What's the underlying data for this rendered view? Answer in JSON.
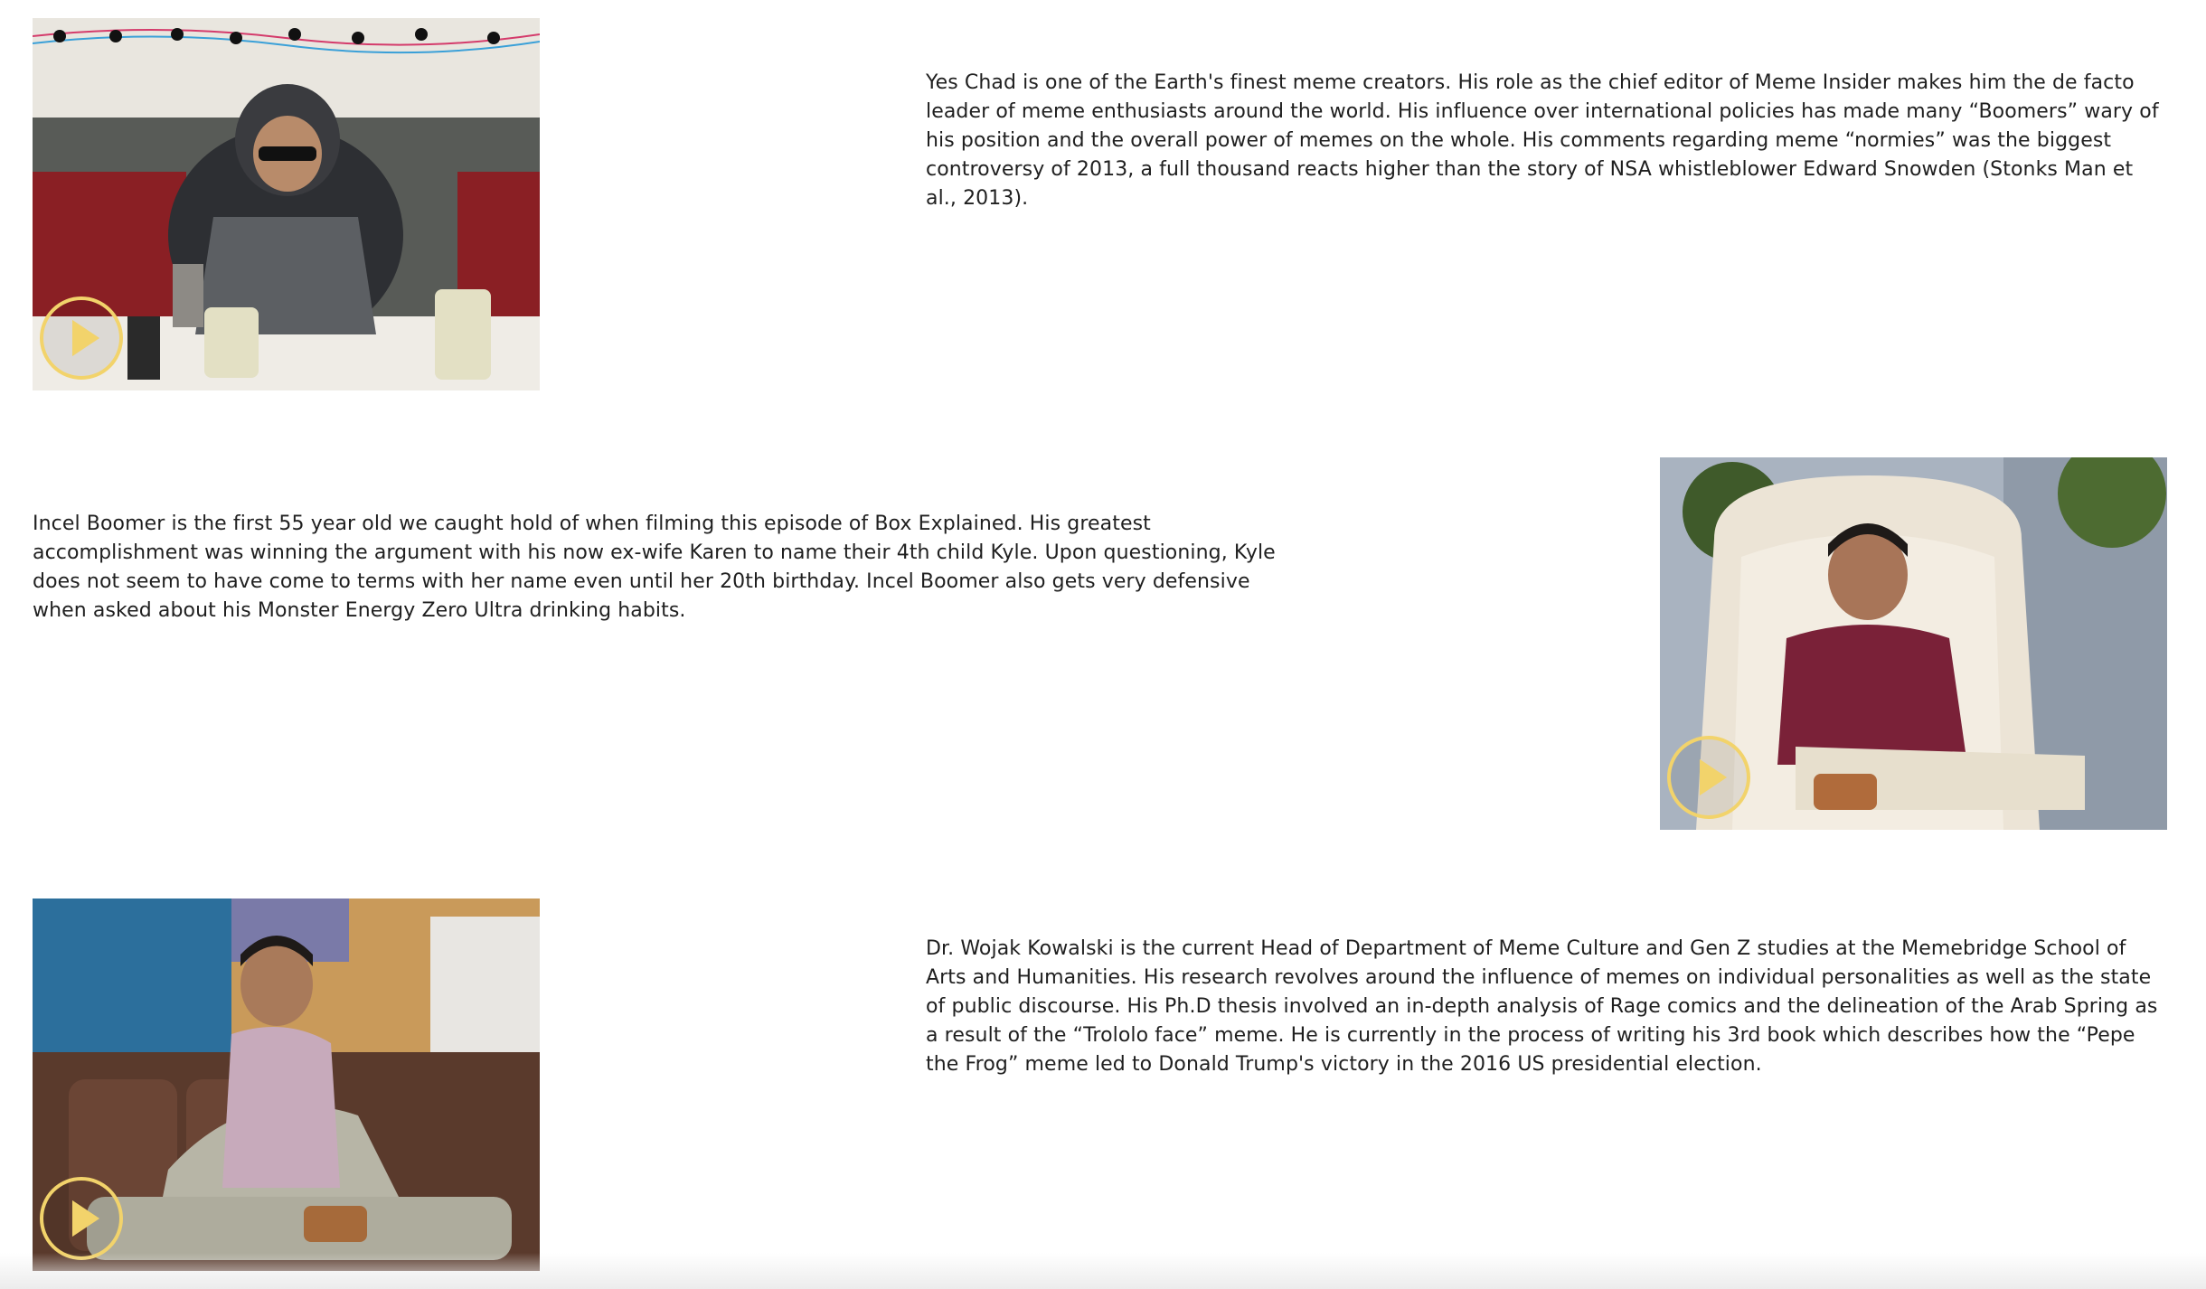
{
  "profiles": [
    {
      "video_label": "Yes Chad video",
      "bio": "Yes Chad is one of the Earth's finest meme creators. His role as the chief editor of Meme Insider makes him the de facto leader of meme enthusiasts around the world. His influence over international policies has made many “Boomers” wary of his position and the overall power of memes on the whole. His comments regarding meme “normies” was the biggest controversy of 2013, a full thousand reacts higher than the story of NSA whistleblower Edward Snowden (Stonks Man et al., 2013)."
    },
    {
      "video_label": "Incel Boomer video",
      "bio": "Incel Boomer is the first 55 year old we caught hold of when filming this episode of Box Explained. His greatest accomplishment was winning the argument with his now ex-wife Karen to name their 4th child Kyle. Upon questioning, Kyle does not seem to have come to terms with her name even until her 20th birthday. Incel Boomer also gets very defensive when asked about his Monster Energy Zero Ultra drinking habits."
    },
    {
      "video_label": "Dr. Wojak Kowalski video",
      "bio": "Dr. Wojak Kowalski is the current Head of Department of Meme Culture and Gen Z studies at the Memebridge School of Arts and Humanities. His research revolves around the influence of memes on individual personalities as well as the state of public discourse. His Ph.D thesis involved an in-depth analysis of Rage comics and the delineation of the Arab Spring as a result of the “Trololo face” meme. He is currently in the process of writing his 3rd book which describes how the “Pepe the Frog” meme led to Donald Trump's victory in the 2016 US presidential election."
    }
  ],
  "icons": {
    "play": "play-icon"
  },
  "colors": {
    "play_accent": "#f2d36b",
    "text": "#1f1f1f",
    "background": "#ffffff"
  }
}
